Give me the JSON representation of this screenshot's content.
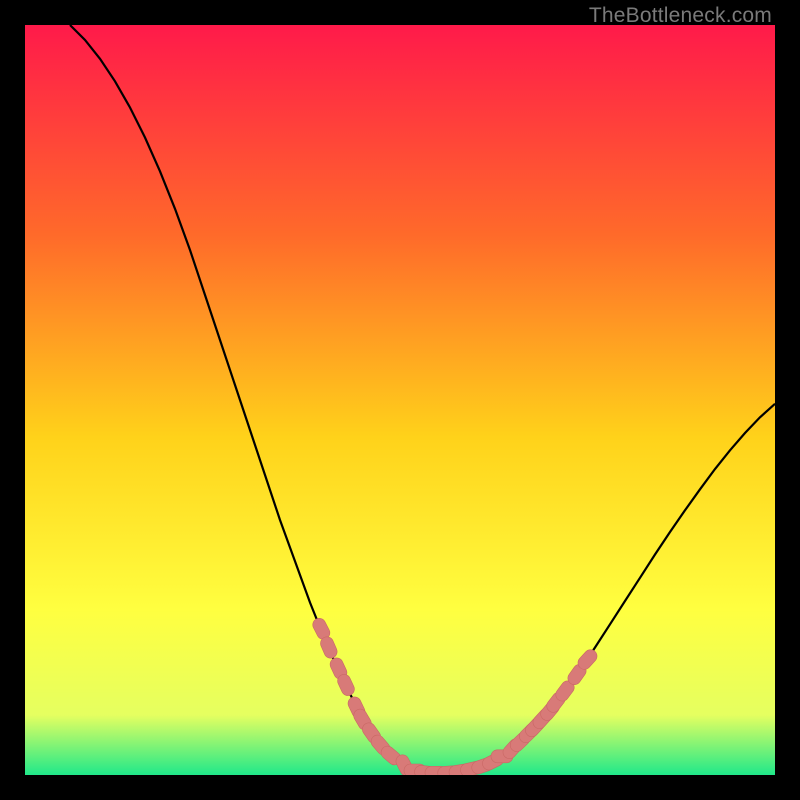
{
  "watermark": "TheBottleneck.com",
  "colors": {
    "gradient_top": "#ff1a4a",
    "gradient_mid1": "#ff6a2a",
    "gradient_mid2": "#ffd21a",
    "gradient_mid3": "#ffff40",
    "gradient_mid4": "#e5ff60",
    "gradient_bottom": "#20e88a",
    "curve": "#000000",
    "marker_fill": "#d87a78",
    "marker_stroke": "#c96865",
    "frame": "#000000"
  },
  "chart_data": {
    "type": "line",
    "title": "",
    "xlabel": "",
    "ylabel": "",
    "xlim": [
      0,
      100
    ],
    "ylim": [
      0,
      100
    ],
    "grid": false,
    "curve": [
      {
        "x": 6,
        "y": 100
      },
      {
        "x": 8,
        "y": 98
      },
      {
        "x": 10,
        "y": 95.5
      },
      {
        "x": 12,
        "y": 92.5
      },
      {
        "x": 14,
        "y": 89
      },
      {
        "x": 16,
        "y": 85
      },
      {
        "x": 18,
        "y": 80.5
      },
      {
        "x": 20,
        "y": 75.5
      },
      {
        "x": 22,
        "y": 70
      },
      {
        "x": 24,
        "y": 64
      },
      {
        "x": 26,
        "y": 58
      },
      {
        "x": 28,
        "y": 52
      },
      {
        "x": 30,
        "y": 46
      },
      {
        "x": 32,
        "y": 40
      },
      {
        "x": 34,
        "y": 34
      },
      {
        "x": 36,
        "y": 28.5
      },
      {
        "x": 38,
        "y": 23
      },
      {
        "x": 40,
        "y": 18
      },
      {
        "x": 42,
        "y": 13.5
      },
      {
        "x": 44,
        "y": 9.5
      },
      {
        "x": 46,
        "y": 6
      },
      {
        "x": 48,
        "y": 3.3
      },
      {
        "x": 50,
        "y": 1.5
      },
      {
        "x": 52,
        "y": 0.6
      },
      {
        "x": 54,
        "y": 0.3
      },
      {
        "x": 56,
        "y": 0.3
      },
      {
        "x": 58,
        "y": 0.5
      },
      {
        "x": 60,
        "y": 0.9
      },
      {
        "x": 62,
        "y": 1.5
      },
      {
        "x": 64,
        "y": 2.7
      },
      {
        "x": 66,
        "y": 4.3
      },
      {
        "x": 68,
        "y": 6.3
      },
      {
        "x": 70,
        "y": 8.6
      },
      {
        "x": 72,
        "y": 11.2
      },
      {
        "x": 74,
        "y": 14
      },
      {
        "x": 76,
        "y": 17
      },
      {
        "x": 78,
        "y": 20.1
      },
      {
        "x": 80,
        "y": 23.2
      },
      {
        "x": 82,
        "y": 26.3
      },
      {
        "x": 84,
        "y": 29.4
      },
      {
        "x": 86,
        "y": 32.4
      },
      {
        "x": 88,
        "y": 35.3
      },
      {
        "x": 90,
        "y": 38.1
      },
      {
        "x": 92,
        "y": 40.8
      },
      {
        "x": 94,
        "y": 43.3
      },
      {
        "x": 96,
        "y": 45.6
      },
      {
        "x": 98,
        "y": 47.7
      },
      {
        "x": 100,
        "y": 49.5
      }
    ],
    "markers_left": [
      {
        "x": 39.5,
        "y": 19.5
      },
      {
        "x": 40.5,
        "y": 17
      },
      {
        "x": 41.8,
        "y": 14.2
      },
      {
        "x": 42.8,
        "y": 12
      },
      {
        "x": 44.2,
        "y": 9
      },
      {
        "x": 45.0,
        "y": 7.4
      },
      {
        "x": 46.2,
        "y": 5.6
      },
      {
        "x": 47.4,
        "y": 4.0
      },
      {
        "x": 48.8,
        "y": 2.6
      },
      {
        "x": 50.6,
        "y": 1.3
      }
    ],
    "markers_bottom": [
      {
        "x": 52.0,
        "y": 0.6
      },
      {
        "x": 53.4,
        "y": 0.35
      },
      {
        "x": 54.8,
        "y": 0.3
      },
      {
        "x": 56.5,
        "y": 0.32
      },
      {
        "x": 58.0,
        "y": 0.5
      },
      {
        "x": 59.5,
        "y": 0.8
      },
      {
        "x": 61.0,
        "y": 1.2
      },
      {
        "x": 62.4,
        "y": 1.8
      },
      {
        "x": 63.6,
        "y": 2.5
      }
    ],
    "markers_right": [
      {
        "x": 65.0,
        "y": 3.5
      },
      {
        "x": 66.0,
        "y": 4.4
      },
      {
        "x": 67.2,
        "y": 5.6
      },
      {
        "x": 68.0,
        "y": 6.4
      },
      {
        "x": 69.0,
        "y": 7.5
      },
      {
        "x": 70.0,
        "y": 8.6
      },
      {
        "x": 70.8,
        "y": 9.7
      },
      {
        "x": 72.0,
        "y": 11.2
      },
      {
        "x": 73.6,
        "y": 13.4
      },
      {
        "x": 75.0,
        "y": 15.4
      }
    ]
  }
}
